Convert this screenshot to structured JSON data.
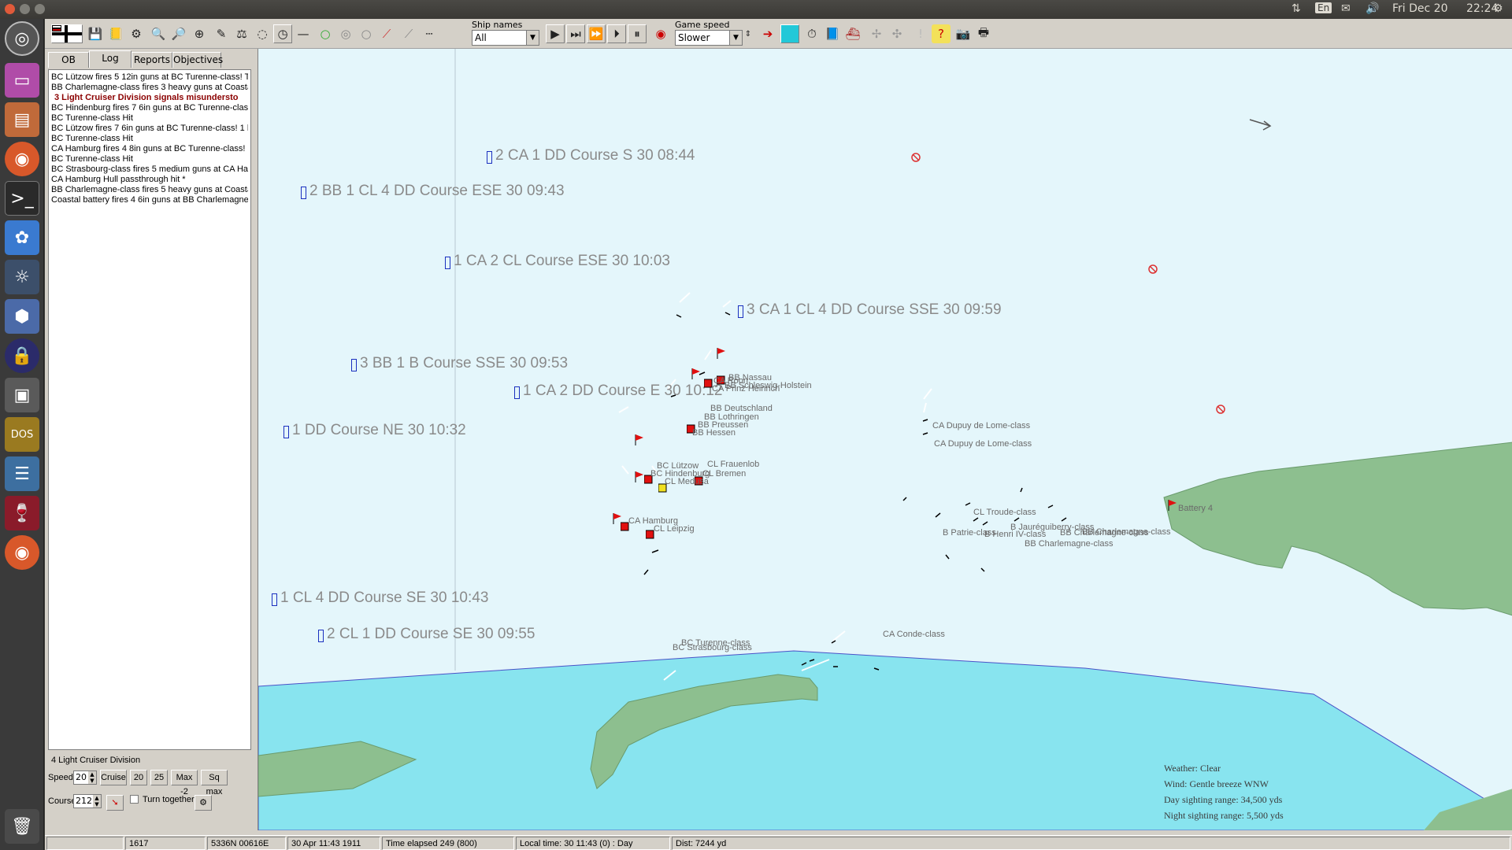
{
  "topbar": {
    "datetime": "Fri Dec 20",
    "time": "22:24",
    "lang": "En",
    "icons": [
      "network-icon",
      "keyboard-lang-icon",
      "mail-icon",
      "volume-icon",
      "settings-gear-icon"
    ]
  },
  "toolbar": {
    "ship_names_label": "Ship names",
    "ship_names_value": "All",
    "game_speed_label": "Game speed",
    "game_speed_value": "Slower"
  },
  "leftpanel": {
    "tabs": [
      "OB",
      "Log",
      "Reports",
      "Objectives"
    ],
    "active_tab": "Log",
    "log": [
      {
        "text": "BC Lützow fires 5 12in guns at BC Turenne-class! Ta",
        "alert": false
      },
      {
        "text": "BB Charlemagne-class fires 3 heavy guns at Coastal",
        "alert": false
      },
      {
        "text": "3 Light Cruiser Division signals misundersto",
        "alert": true
      },
      {
        "text": "BC Hindenburg fires 7 6in guns at BC Turenne-class!",
        "alert": false
      },
      {
        "text": "BC Turenne-class Hit",
        "alert": false
      },
      {
        "text": "BC Lützow fires 7 6in guns at BC Turenne-class! 1 hit",
        "alert": false
      },
      {
        "text": "BC Turenne-class Hit",
        "alert": false
      },
      {
        "text": "CA Hamburg fires 4 8in guns at BC Turenne-class! 1",
        "alert": false
      },
      {
        "text": "BC Turenne-class Hit",
        "alert": false
      },
      {
        "text": "BC Strasbourg-class fires 5 medium guns at CA Hamb",
        "alert": false
      },
      {
        "text": "CA Hamburg Hull passthrough hit *",
        "alert": false
      },
      {
        "text": "BB Charlemagne-class fires 5 heavy guns at Coastal",
        "alert": false
      },
      {
        "text": "Coastal battery fires 4 6in guns at BB Charlemagne-cl",
        "alert": false
      }
    ],
    "division_name": "4 Light Cruiser Division",
    "speed_label": "Speed",
    "speed_value": "20",
    "btn_cruise": "Cruise",
    "btn_20": "20",
    "btn_25": "25",
    "btn_max2": "Max -2",
    "btn_sqmax": "Sq max",
    "course_label": "Course",
    "course_value": "212",
    "turn_together_label": "Turn together"
  },
  "map": {
    "groups": [
      "2 CA 1 DD Course S 30 08:44",
      "2 BB 1 CL 4 DD Course ESE 30 09:43",
      "1 CA 2 CL Course ESE 30 10:03",
      "3 CA 1 CL 4 DD Course SSE 30 09:59",
      "3 BB 1 B Course SSE 30 09:53",
      "1 CA 2 DD Course E 30 10:12",
      "1 DD Course NE 30 10:32",
      "1 CL 4 DD Course SE 30 10:43",
      "2 CL 1 DD Course SE 30 09:55"
    ],
    "ship_labels": [
      "BB Nassau",
      "CA Roon",
      "BB Schleswig-Holstein",
      "CA Prinz Heinrich",
      "BB Deutschland",
      "BB Lothringen",
      "BB Preussen",
      "BB Hessen",
      "BC Lützow",
      "BC Hindenburg",
      "CL Frauenlob",
      "CL Bremen",
      "CL Medusa",
      "CA Hamburg",
      "CL Leipzig",
      "CA Dupuy de Lome-class",
      "CA Dupuy de Lome-class",
      "CL Troude-class",
      "B Patrie-class",
      "B Jauréguiberry-class",
      "B Henri IV-class",
      "BB Charlemagne-class",
      "BB Charlemagne-class",
      "BB Charlemagne-class",
      "BC Turenne-class",
      "BC Strasbourg-class",
      "CA Conde-class",
      "Battery 4"
    ],
    "weather": {
      "line1": "Weather: Clear",
      "line2": "Wind: Gentle breeze  WNW",
      "line3": "Day sighting range: 34,500 yds",
      "line4": "Night sighting range: 5,500 yds"
    },
    "colors": {
      "deep_sea": "#e4f6fb",
      "shallow": "#88e4ef",
      "land": "#8dbf8f",
      "german_flag": "#e01010"
    }
  },
  "status": {
    "s1": "1617",
    "s2": "5336N 00616E",
    "s3": "30 Apr 11:43 1911",
    "s4": "Time elapsed 249 (800)",
    "s5": "Local time: 30 11:43 (0) : Day",
    "s6": "Dist: 7244 yd"
  }
}
